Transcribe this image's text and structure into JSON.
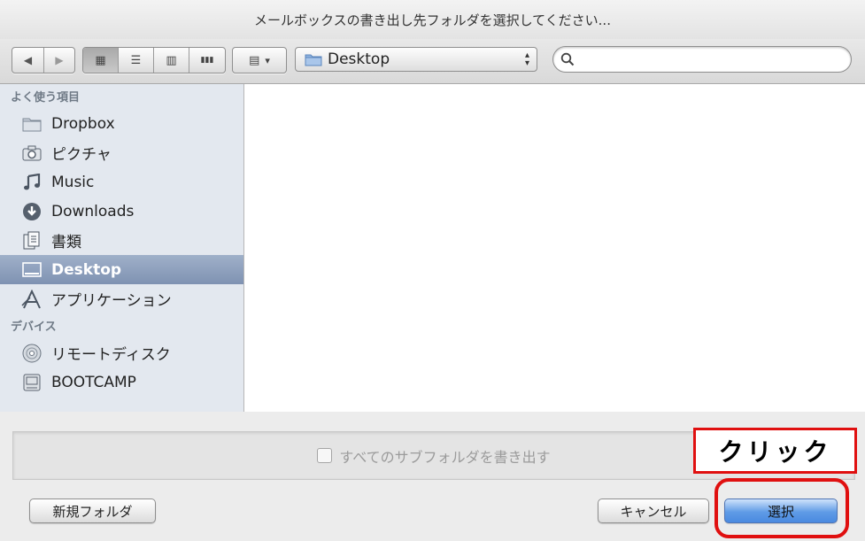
{
  "dialog": {
    "title": "メールボックスの書き出し先フォルダを選択してください..."
  },
  "toolbar": {
    "back_icon": "◀",
    "forward_icon": "▶",
    "view_icons": [
      "▦",
      "☰",
      "▥",
      "▮▮▮"
    ],
    "arrange_icon": "▤",
    "arrange_arrow": "▾",
    "location": "Desktop",
    "search_placeholder": ""
  },
  "sidebar": {
    "favorites_header": "よく使う項目",
    "favorites": [
      {
        "label": "Dropbox",
        "icon": "folder-icon"
      },
      {
        "label": "ピクチャ",
        "icon": "camera-icon"
      },
      {
        "label": "Music",
        "icon": "music-note-icon"
      },
      {
        "label": "Downloads",
        "icon": "download-icon"
      },
      {
        "label": "書類",
        "icon": "documents-icon"
      },
      {
        "label": "Desktop",
        "icon": "desktop-icon"
      },
      {
        "label": "アプリケーション",
        "icon": "applications-icon"
      }
    ],
    "devices_header": "デバイス",
    "devices": [
      {
        "label": "リモートディスク",
        "icon": "disc-icon"
      },
      {
        "label": "BOOTCAMP",
        "icon": "hard-drive-icon"
      }
    ]
  },
  "options": {
    "export_subfolders_label": "すべてのサブフォルダを書き出す",
    "export_subfolders_checked": false
  },
  "buttons": {
    "new_folder": "新規フォルダ",
    "cancel": "キャンセル",
    "select": "選択"
  },
  "annotation": {
    "callout_text": "クリック",
    "color": "#e01010"
  }
}
